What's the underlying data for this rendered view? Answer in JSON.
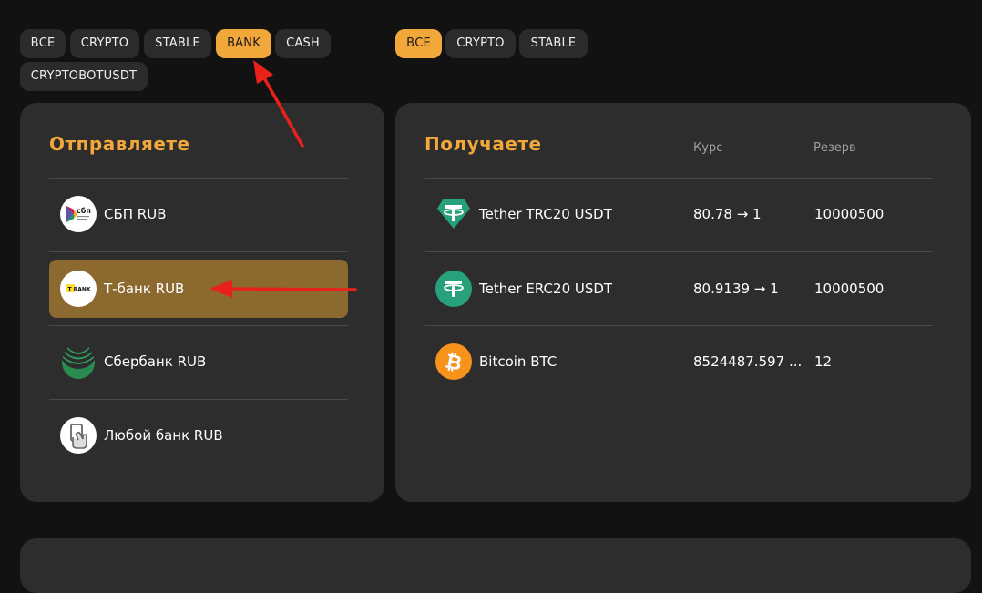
{
  "send_filters": [
    {
      "label": "ВСЕ",
      "active": false
    },
    {
      "label": "CRYPTO",
      "active": false
    },
    {
      "label": "STABLE",
      "active": false
    },
    {
      "label": "BANK",
      "active": true
    },
    {
      "label": "CASH",
      "active": false
    },
    {
      "label": "CRYPTOBOTUSDT",
      "active": false
    }
  ],
  "receive_filters": [
    {
      "label": "ВСЕ",
      "active": true
    },
    {
      "label": "CRYPTO",
      "active": false
    },
    {
      "label": "STABLE",
      "active": false
    }
  ],
  "send_panel": {
    "title": "Отправляете",
    "items": [
      {
        "label": "СБП RUB",
        "icon": "sbp-logo-icon",
        "selected": false
      },
      {
        "label": "Т-банк RUB",
        "icon": "tbank-logo-icon",
        "selected": true
      },
      {
        "label": "Сбербанк RUB",
        "icon": "sberbank-logo-icon",
        "selected": false
      },
      {
        "label": "Любой банк RUB",
        "icon": "card-hand-icon",
        "selected": false
      }
    ]
  },
  "sbp_icon_text": "сбп",
  "tbank_icon_text": "T BANK",
  "receive_panel": {
    "title": "Получаете",
    "col_rate": "Курс",
    "col_reserve": "Резерв",
    "items": [
      {
        "label": "Tether TRC20 USDT",
        "rate": "80.78 → 1",
        "reserve": "10000500",
        "icon": "tether-trc20-icon"
      },
      {
        "label": "Tether ERC20 USDT",
        "rate": "80.9139 → 1",
        "reserve": "10000500",
        "icon": "tether-erc20-icon"
      },
      {
        "label": "Bitcoin BTC",
        "rate": "8524487.597 ...",
        "reserve": "12",
        "icon": "bitcoin-icon"
      }
    ]
  },
  "colors": {
    "background": "#121212",
    "panel": "#2d2d2d",
    "accent": "#f2a73b",
    "selected_row": "#8c6a2f",
    "annotation_arrow": "#e8221a"
  }
}
